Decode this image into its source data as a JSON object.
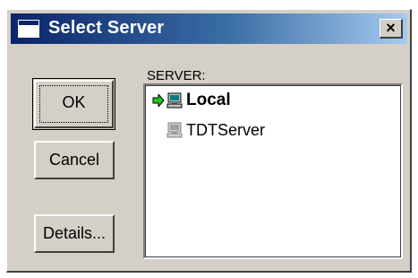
{
  "window": {
    "title": "Select Server",
    "close_label": "×"
  },
  "buttons": {
    "ok_label": "OK",
    "cancel_label": "Cancel",
    "details_label": "Details..."
  },
  "server_list": {
    "label": "SERVER:",
    "items": [
      {
        "name": "Local",
        "selected": true,
        "icon": "computer-icon",
        "marker": "green-arrow-icon"
      },
      {
        "name": "TDTServer",
        "selected": false,
        "icon": "computer-icon"
      }
    ]
  },
  "colors": {
    "titlebar_start": "#0a246a",
    "titlebar_end": "#a6caf0",
    "dialog_face": "#d4d0c8",
    "arrow": "#22c322"
  }
}
